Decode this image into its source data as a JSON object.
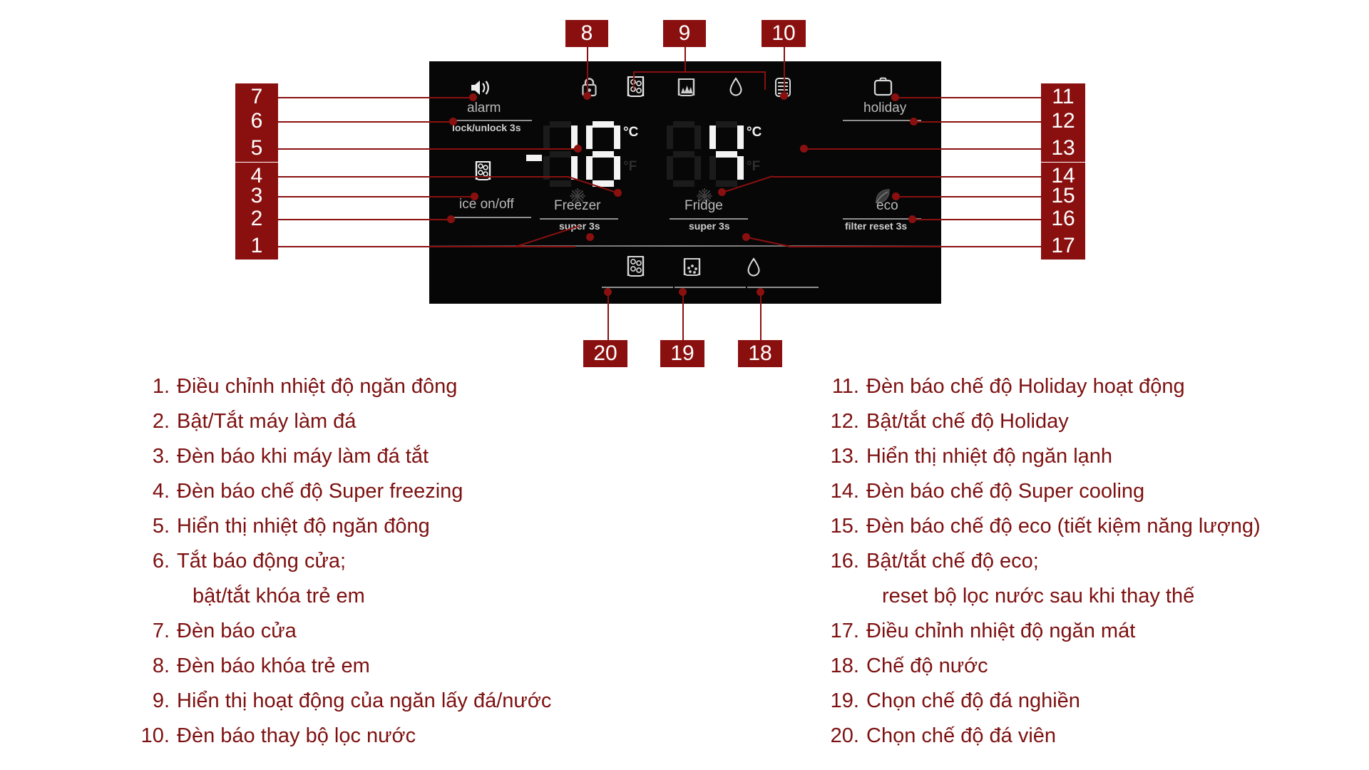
{
  "panel": {
    "freezer": {
      "minus_sign": "-",
      "value": "18",
      "digits": [
        {
          "char": "1",
          "segments": [
            "B",
            "C"
          ]
        },
        {
          "char": "8",
          "segments": [
            "A",
            "B",
            "C",
            "D",
            "E",
            "F",
            "G"
          ]
        }
      ],
      "unit_c": "°C",
      "unit_f": "°F",
      "unit_active": "°C",
      "section_label": "Freezer",
      "sub_label": "super 3s",
      "snowflake_icon": "snowflake-icon"
    },
    "fridge": {
      "value": "4",
      "digits": [
        {
          "char": " ",
          "segments": []
        },
        {
          "char": "4",
          "segments": [
            "B",
            "C",
            "F",
            "G"
          ]
        }
      ],
      "unit_c": "°C",
      "unit_f": "°F",
      "unit_active": "°C",
      "section_label": "Fridge",
      "sub_label": "super 3s",
      "snowflake_icon": "snowflake-icon"
    },
    "alarm": {
      "icon": "speaker-alarm-icon",
      "label": "alarm",
      "sub_label": "lock/unlock 3s"
    },
    "ice": {
      "icon": "ice-cubes-glass-icon",
      "label": "ice on/off"
    },
    "eco": {
      "icon": "eco-leaf-icon",
      "label": "eco",
      "sub_label": "filter reset 3s"
    },
    "holiday": {
      "icon": "suitcase-icon",
      "label": "holiday"
    },
    "top_indicators": [
      {
        "name": "child-lock-icon",
        "title": "lock"
      },
      {
        "name": "cubed-ice-icon",
        "title": "cubed ice"
      },
      {
        "name": "crushed-ice-icon",
        "title": "crushed ice"
      },
      {
        "name": "water-drop-icon",
        "title": "water"
      },
      {
        "name": "water-filter-icon",
        "title": "water filter"
      }
    ],
    "bottom_buttons": [
      {
        "name": "cubed-ice-button",
        "title": "cubed ice"
      },
      {
        "name": "crushed-ice-button",
        "title": "crushed ice"
      },
      {
        "name": "water-button",
        "title": "water"
      }
    ]
  },
  "callouts": [
    {
      "id": "1",
      "label": "1"
    },
    {
      "id": "2",
      "label": "2"
    },
    {
      "id": "3",
      "label": "3"
    },
    {
      "id": "4",
      "label": "4"
    },
    {
      "id": "5",
      "label": "5"
    },
    {
      "id": "6",
      "label": "6"
    },
    {
      "id": "7",
      "label": "7"
    },
    {
      "id": "8",
      "label": "8"
    },
    {
      "id": "9",
      "label": "9"
    },
    {
      "id": "10",
      "label": "10"
    },
    {
      "id": "11",
      "label": "11"
    },
    {
      "id": "12",
      "label": "12"
    },
    {
      "id": "13",
      "label": "13"
    },
    {
      "id": "14",
      "label": "14"
    },
    {
      "id": "15",
      "label": "15"
    },
    {
      "id": "16",
      "label": "16"
    },
    {
      "id": "17",
      "label": "17"
    },
    {
      "id": "18",
      "label": "18"
    },
    {
      "id": "19",
      "label": "19"
    },
    {
      "id": "20",
      "label": "20"
    }
  ],
  "legend": {
    "left_column": [
      {
        "num": "1.",
        "text": "Điều chỉnh nhiệt độ ngăn đông",
        "continuation": false
      },
      {
        "num": "2.",
        "text": "Bật/Tắt máy làm đá",
        "continuation": false
      },
      {
        "num": "3.",
        "text": "Đèn báo khi máy làm đá tắt",
        "continuation": false
      },
      {
        "num": "4.",
        "text": "Đèn báo chế độ Super freezing",
        "continuation": false
      },
      {
        "num": "5.",
        "text": "Hiển thị nhiệt độ ngăn đông",
        "continuation": false
      },
      {
        "num": "6.",
        "text": "Tắt báo động cửa;",
        "continuation": false
      },
      {
        "num": "",
        "text": "bật/tắt khóa trẻ em",
        "continuation": true
      },
      {
        "num": "7.",
        "text": "Đèn báo cửa",
        "continuation": false
      },
      {
        "num": "8.",
        "text": "Đèn báo khóa trẻ em",
        "continuation": false
      },
      {
        "num": "9.",
        "text": "Hiển thị hoạt động của ngăn lấy đá/nước",
        "continuation": false
      },
      {
        "num": "10.",
        "text": "Đèn báo thay bộ lọc nước",
        "continuation": false
      }
    ],
    "right_column": [
      {
        "num": "11.",
        "text": "Đèn báo chế độ Holiday hoạt động",
        "continuation": false
      },
      {
        "num": "12.",
        "text": "Bật/tắt chế độ Holiday",
        "continuation": false
      },
      {
        "num": "13.",
        "text": "Hiển thị nhiệt độ ngăn lạnh",
        "continuation": false
      },
      {
        "num": "14.",
        "text": "Đèn báo chế độ Super cooling",
        "continuation": false
      },
      {
        "num": "15.",
        "text": "Đèn báo chế độ eco (tiết kiệm năng lượng)",
        "continuation": false
      },
      {
        "num": "16.",
        "text": "Bật/tắt chế độ eco;",
        "continuation": false
      },
      {
        "num": "",
        "text": "reset bộ lọc nước sau khi thay thế",
        "continuation": true
      },
      {
        "num": "17.",
        "text": "Điều chỉnh nhiệt độ ngăn mát",
        "continuation": false
      },
      {
        "num": "18.",
        "text": "Chế độ nước",
        "continuation": false
      },
      {
        "num": "19.",
        "text": "Chọn chế độ đá nghiền",
        "continuation": false
      },
      {
        "num": "20.",
        "text": "Chọn chế độ đá viên",
        "continuation": false
      }
    ]
  },
  "colors": {
    "accent": "#8a1010",
    "text": "#7d1010",
    "panel_bg": "#050505",
    "segment_on": "#f4f4f4",
    "segment_off": "#1b1b1b"
  }
}
